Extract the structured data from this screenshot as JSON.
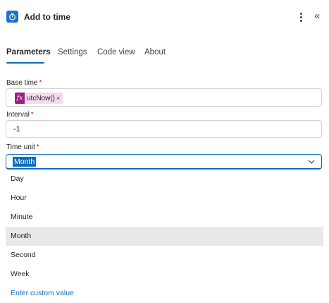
{
  "header": {
    "title": "Add to time",
    "collapse_glyph": "«"
  },
  "tabs": [
    {
      "label": "Parameters",
      "active": true
    },
    {
      "label": "Settings",
      "active": false
    },
    {
      "label": "Code view",
      "active": false
    },
    {
      "label": "About",
      "active": false
    }
  ],
  "fields": {
    "base_time": {
      "label": "Base time",
      "required_mark": "*",
      "token_icon": "fx",
      "token_text": "utcNow()",
      "token_remove": "×"
    },
    "interval": {
      "label": "Interval",
      "required_mark": "*",
      "value": "-1"
    },
    "time_unit": {
      "label": "Time unit",
      "required_mark": "*",
      "value": "Month"
    }
  },
  "dropdown": {
    "options": [
      "Day",
      "Hour",
      "Minute",
      "Month",
      "Second",
      "Week"
    ],
    "selected": "Month",
    "custom_label": "Enter custom value"
  },
  "colors": {
    "accent": "#0f6cbd",
    "token_bg": "#f3dbef",
    "fx_bg": "#9b1f84",
    "required": "#c50f1f",
    "selected_option_bg": "#ebe9e7",
    "app_icon_bg": "#1f6fd1"
  },
  "icons": [
    "timer-icon",
    "more-options-icon",
    "collapse-icon",
    "function-icon",
    "chevron-down-icon"
  ]
}
